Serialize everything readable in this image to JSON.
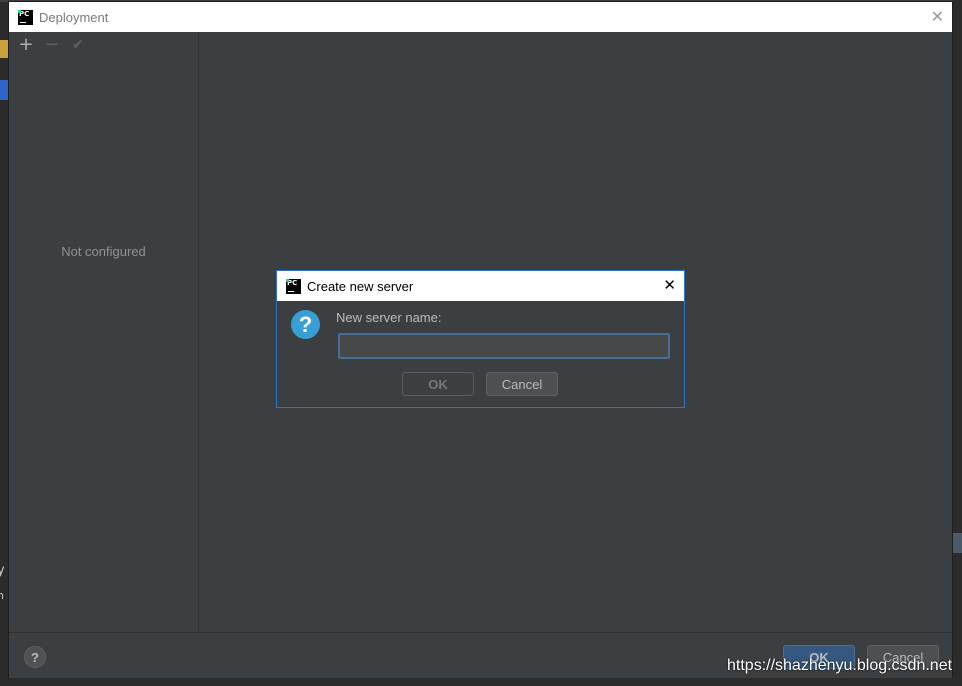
{
  "main_window": {
    "title": "Deployment",
    "toolbar": {
      "add_icon": "+",
      "remove_icon": "−",
      "apply_icon": "✔"
    },
    "empty_state": "Not configured",
    "help_label": "?",
    "ok_label": "OK",
    "cancel_label": "Cancel"
  },
  "dialog": {
    "title": "Create new server",
    "question_icon": "?",
    "field_label": "New server name:",
    "field_value": "",
    "ok_label": "OK",
    "cancel_label": "Cancel"
  },
  "background": {
    "left_fragment_1": "y",
    "left_fragment_2": "n"
  },
  "watermark": "https://shazhenyu.blog.csdn.net",
  "colors": {
    "accent": "#2d74c5",
    "panel": "#3c3f41",
    "primary_button": "#365880",
    "question_icon": "#389fd6"
  }
}
